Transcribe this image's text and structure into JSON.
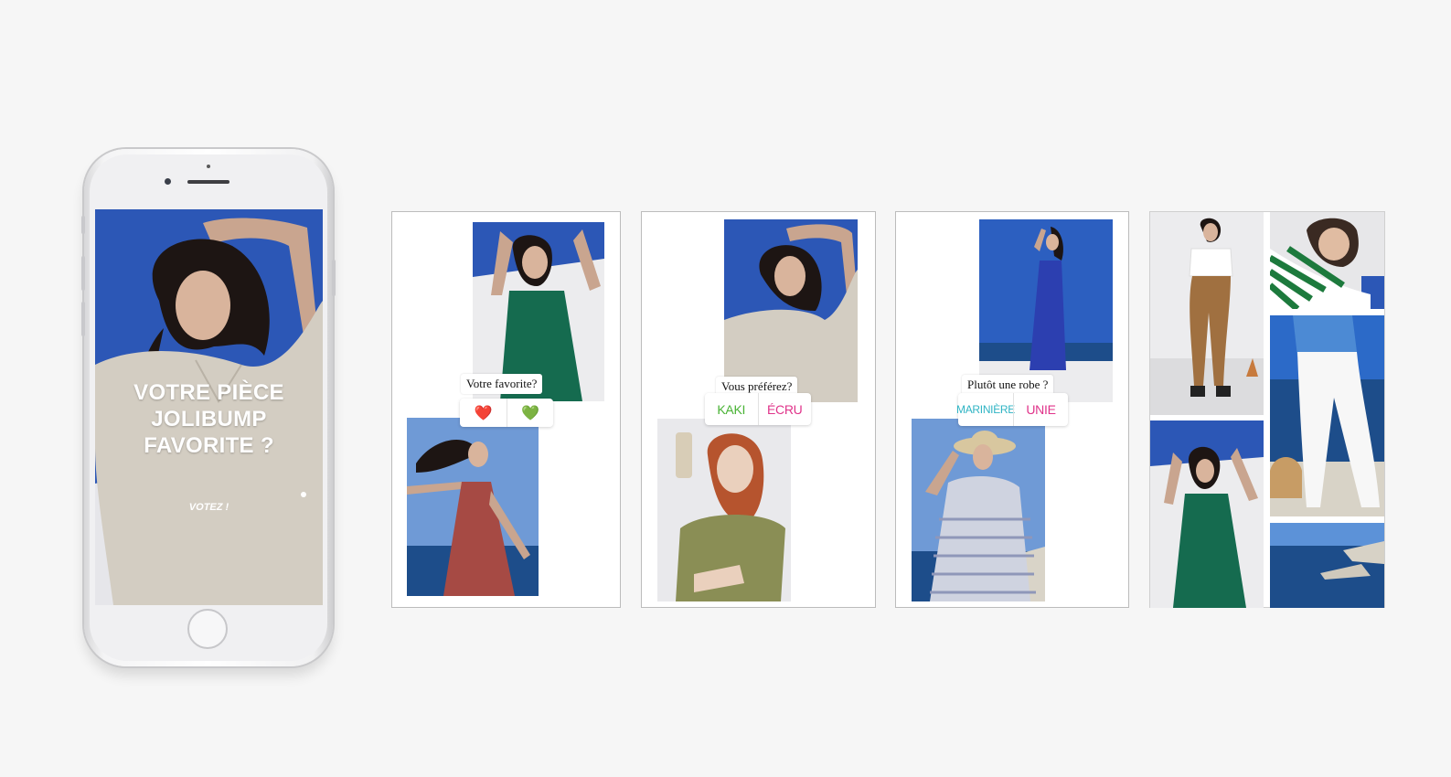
{
  "phone": {
    "title": "VOTRE PIÈCE\nJOLIBUMP\nFAVORITE ?",
    "cta": "VOTEZ !"
  },
  "stories": [
    {
      "question": "Votre favorite?",
      "options": [
        "❤️",
        "💚"
      ],
      "colors": [
        "#d71920",
        "#3cae2f"
      ]
    },
    {
      "question": "Vous préférez?",
      "options": [
        "KAKI",
        "ÉCRU"
      ],
      "colors": [
        "#49b335",
        "#e0338a"
      ]
    },
    {
      "question": "Plutôt une robe ?",
      "options": [
        "MARINIÈRE",
        "UNIE"
      ],
      "colors": [
        "#2fb4c4",
        "#e0338a"
      ]
    }
  ],
  "colors": {
    "sky": "#2c57b6",
    "sea": "#1d4d8a",
    "dress_green": "#156b4f",
    "dress_red": "#a64a44",
    "dress_blue": "#2c3fb0",
    "shirt_beige": "#d3cdc2",
    "shirt_khaki": "#8a8e55"
  }
}
